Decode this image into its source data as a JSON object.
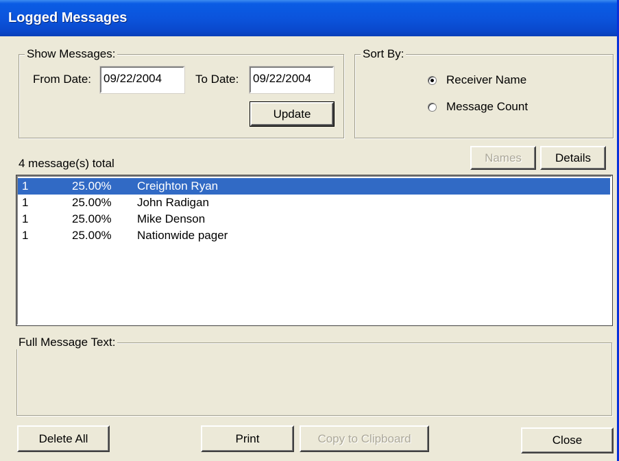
{
  "window": {
    "title": "Logged Messages"
  },
  "show_messages": {
    "legend": "Show Messages:",
    "from_label": "From Date:",
    "from_value": "09/22/2004",
    "to_label": "To Date:",
    "to_value": "09/22/2004",
    "update_label": "Update"
  },
  "sort_by": {
    "legend": "Sort By:",
    "options": [
      {
        "label": "Receiver Name",
        "selected": true
      },
      {
        "label": "Message Count",
        "selected": false
      }
    ]
  },
  "messages": {
    "total_text": "4 message(s) total",
    "names_label": "Names",
    "details_label": "Details",
    "rows": [
      {
        "count": "1",
        "percent": "25.00%",
        "name": "Creighton Ryan",
        "selected": true
      },
      {
        "count": "1",
        "percent": "25.00%",
        "name": "John Radigan",
        "selected": false
      },
      {
        "count": "1",
        "percent": "25.00%",
        "name": "Mike Denson",
        "selected": false
      },
      {
        "count": "1",
        "percent": "25.00%",
        "name": "Nationwide pager",
        "selected": false
      }
    ]
  },
  "full_text": {
    "legend": "Full Message Text:"
  },
  "footer": {
    "delete_all_label": "Delete All",
    "print_label": "Print",
    "copy_label": "Copy to Clipboard",
    "close_label": "Close"
  },
  "colors": {
    "title_bar": "#0b54dc",
    "face": "#ece9d8",
    "selection": "#316ac5"
  }
}
